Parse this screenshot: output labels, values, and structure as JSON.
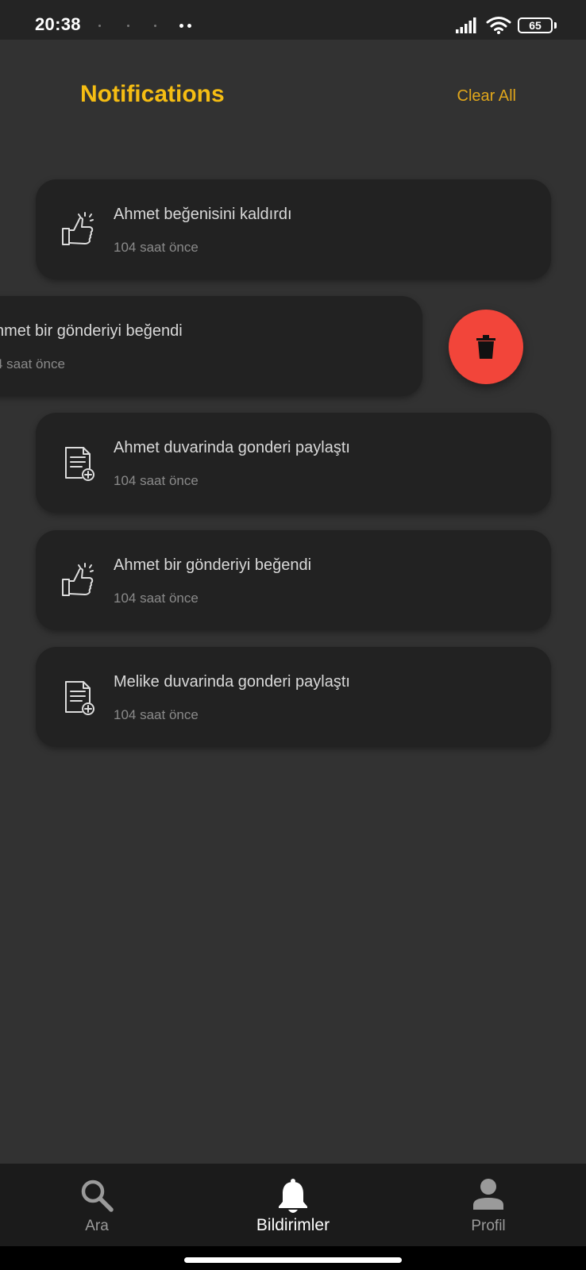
{
  "status_bar": {
    "time": "20:38",
    "battery": "65",
    "icons": [
      "signal-icon",
      "wifi-icon",
      "battery-icon"
    ]
  },
  "header": {
    "title": "Notifications",
    "clear_all": "Clear All"
  },
  "notifications": [
    {
      "icon": "thumbs-up-icon",
      "title": "Ahmet beğenisini kaldırdı",
      "time": "104 saat önce"
    },
    {
      "icon": "thumbs-up-icon",
      "title": "hmet bir gönderiyi beğendi",
      "time": "4 saat önce",
      "swiped": true
    },
    {
      "icon": "document-add-icon",
      "title": "Ahmet duvarinda gonderi paylaştı",
      "time": "104 saat önce"
    },
    {
      "icon": "thumbs-up-icon",
      "title": "Ahmet bir gönderiyi beğendi",
      "time": "104 saat önce"
    },
    {
      "icon": "document-add-icon",
      "title": "Melike duvarinda gonderi paylaştı",
      "time": "104 saat önce"
    }
  ],
  "delete_action": {
    "icon": "trash-icon",
    "color": "#f2453a"
  },
  "bottom_nav": {
    "items": [
      {
        "label": "Ara",
        "icon": "search-icon",
        "active": false
      },
      {
        "label": "Bildirimler",
        "icon": "bell-icon",
        "active": true
      },
      {
        "label": "Profil",
        "icon": "person-icon",
        "active": false
      }
    ]
  },
  "colors": {
    "accent": "#f5bd13",
    "background": "#323232",
    "card": "#222222",
    "danger": "#f2453a"
  }
}
